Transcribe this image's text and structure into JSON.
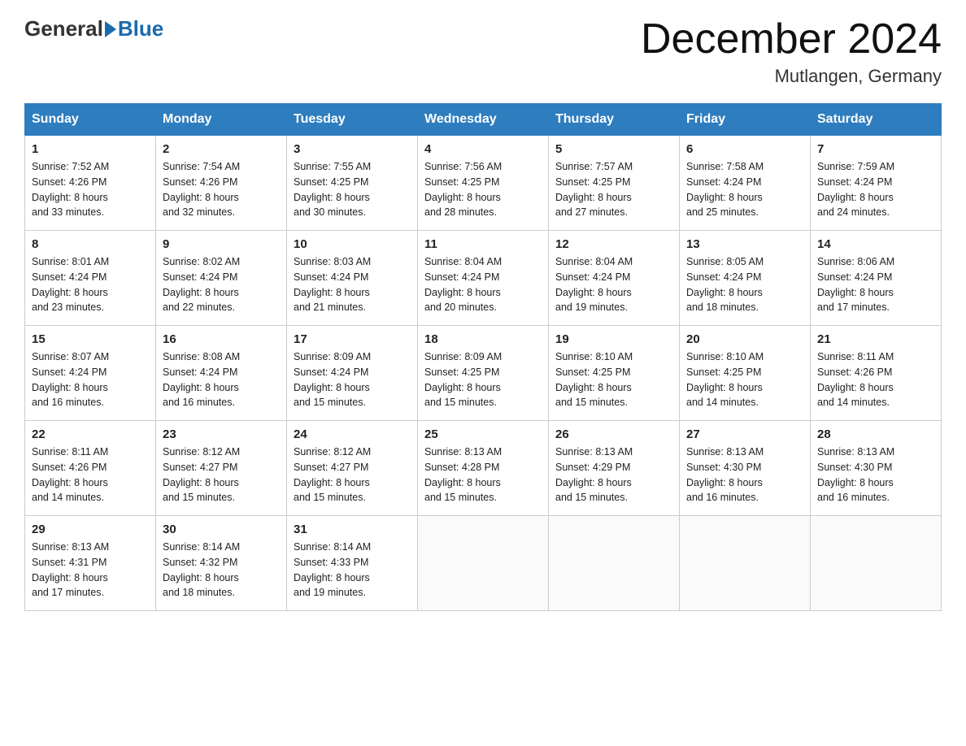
{
  "header": {
    "logo_general": "General",
    "logo_blue": "Blue",
    "month_title": "December 2024",
    "location": "Mutlangen, Germany"
  },
  "days_of_week": [
    "Sunday",
    "Monday",
    "Tuesday",
    "Wednesday",
    "Thursday",
    "Friday",
    "Saturday"
  ],
  "weeks": [
    [
      {
        "day": "1",
        "sunrise": "7:52 AM",
        "sunset": "4:26 PM",
        "daylight": "8 hours and 33 minutes."
      },
      {
        "day": "2",
        "sunrise": "7:54 AM",
        "sunset": "4:26 PM",
        "daylight": "8 hours and 32 minutes."
      },
      {
        "day": "3",
        "sunrise": "7:55 AM",
        "sunset": "4:25 PM",
        "daylight": "8 hours and 30 minutes."
      },
      {
        "day": "4",
        "sunrise": "7:56 AM",
        "sunset": "4:25 PM",
        "daylight": "8 hours and 28 minutes."
      },
      {
        "day": "5",
        "sunrise": "7:57 AM",
        "sunset": "4:25 PM",
        "daylight": "8 hours and 27 minutes."
      },
      {
        "day": "6",
        "sunrise": "7:58 AM",
        "sunset": "4:24 PM",
        "daylight": "8 hours and 25 minutes."
      },
      {
        "day": "7",
        "sunrise": "7:59 AM",
        "sunset": "4:24 PM",
        "daylight": "8 hours and 24 minutes."
      }
    ],
    [
      {
        "day": "8",
        "sunrise": "8:01 AM",
        "sunset": "4:24 PM",
        "daylight": "8 hours and 23 minutes."
      },
      {
        "day": "9",
        "sunrise": "8:02 AM",
        "sunset": "4:24 PM",
        "daylight": "8 hours and 22 minutes."
      },
      {
        "day": "10",
        "sunrise": "8:03 AM",
        "sunset": "4:24 PM",
        "daylight": "8 hours and 21 minutes."
      },
      {
        "day": "11",
        "sunrise": "8:04 AM",
        "sunset": "4:24 PM",
        "daylight": "8 hours and 20 minutes."
      },
      {
        "day": "12",
        "sunrise": "8:04 AM",
        "sunset": "4:24 PM",
        "daylight": "8 hours and 19 minutes."
      },
      {
        "day": "13",
        "sunrise": "8:05 AM",
        "sunset": "4:24 PM",
        "daylight": "8 hours and 18 minutes."
      },
      {
        "day": "14",
        "sunrise": "8:06 AM",
        "sunset": "4:24 PM",
        "daylight": "8 hours and 17 minutes."
      }
    ],
    [
      {
        "day": "15",
        "sunrise": "8:07 AM",
        "sunset": "4:24 PM",
        "daylight": "8 hours and 16 minutes."
      },
      {
        "day": "16",
        "sunrise": "8:08 AM",
        "sunset": "4:24 PM",
        "daylight": "8 hours and 16 minutes."
      },
      {
        "day": "17",
        "sunrise": "8:09 AM",
        "sunset": "4:24 PM",
        "daylight": "8 hours and 15 minutes."
      },
      {
        "day": "18",
        "sunrise": "8:09 AM",
        "sunset": "4:25 PM",
        "daylight": "8 hours and 15 minutes."
      },
      {
        "day": "19",
        "sunrise": "8:10 AM",
        "sunset": "4:25 PM",
        "daylight": "8 hours and 15 minutes."
      },
      {
        "day": "20",
        "sunrise": "8:10 AM",
        "sunset": "4:25 PM",
        "daylight": "8 hours and 14 minutes."
      },
      {
        "day": "21",
        "sunrise": "8:11 AM",
        "sunset": "4:26 PM",
        "daylight": "8 hours and 14 minutes."
      }
    ],
    [
      {
        "day": "22",
        "sunrise": "8:11 AM",
        "sunset": "4:26 PM",
        "daylight": "8 hours and 14 minutes."
      },
      {
        "day": "23",
        "sunrise": "8:12 AM",
        "sunset": "4:27 PM",
        "daylight": "8 hours and 15 minutes."
      },
      {
        "day": "24",
        "sunrise": "8:12 AM",
        "sunset": "4:27 PM",
        "daylight": "8 hours and 15 minutes."
      },
      {
        "day": "25",
        "sunrise": "8:13 AM",
        "sunset": "4:28 PM",
        "daylight": "8 hours and 15 minutes."
      },
      {
        "day": "26",
        "sunrise": "8:13 AM",
        "sunset": "4:29 PM",
        "daylight": "8 hours and 15 minutes."
      },
      {
        "day": "27",
        "sunrise": "8:13 AM",
        "sunset": "4:30 PM",
        "daylight": "8 hours and 16 minutes."
      },
      {
        "day": "28",
        "sunrise": "8:13 AM",
        "sunset": "4:30 PM",
        "daylight": "8 hours and 16 minutes."
      }
    ],
    [
      {
        "day": "29",
        "sunrise": "8:13 AM",
        "sunset": "4:31 PM",
        "daylight": "8 hours and 17 minutes."
      },
      {
        "day": "30",
        "sunrise": "8:14 AM",
        "sunset": "4:32 PM",
        "daylight": "8 hours and 18 minutes."
      },
      {
        "day": "31",
        "sunrise": "8:14 AM",
        "sunset": "4:33 PM",
        "daylight": "8 hours and 19 minutes."
      },
      null,
      null,
      null,
      null
    ]
  ],
  "labels": {
    "sunrise": "Sunrise:",
    "sunset": "Sunset:",
    "daylight": "Daylight:"
  }
}
